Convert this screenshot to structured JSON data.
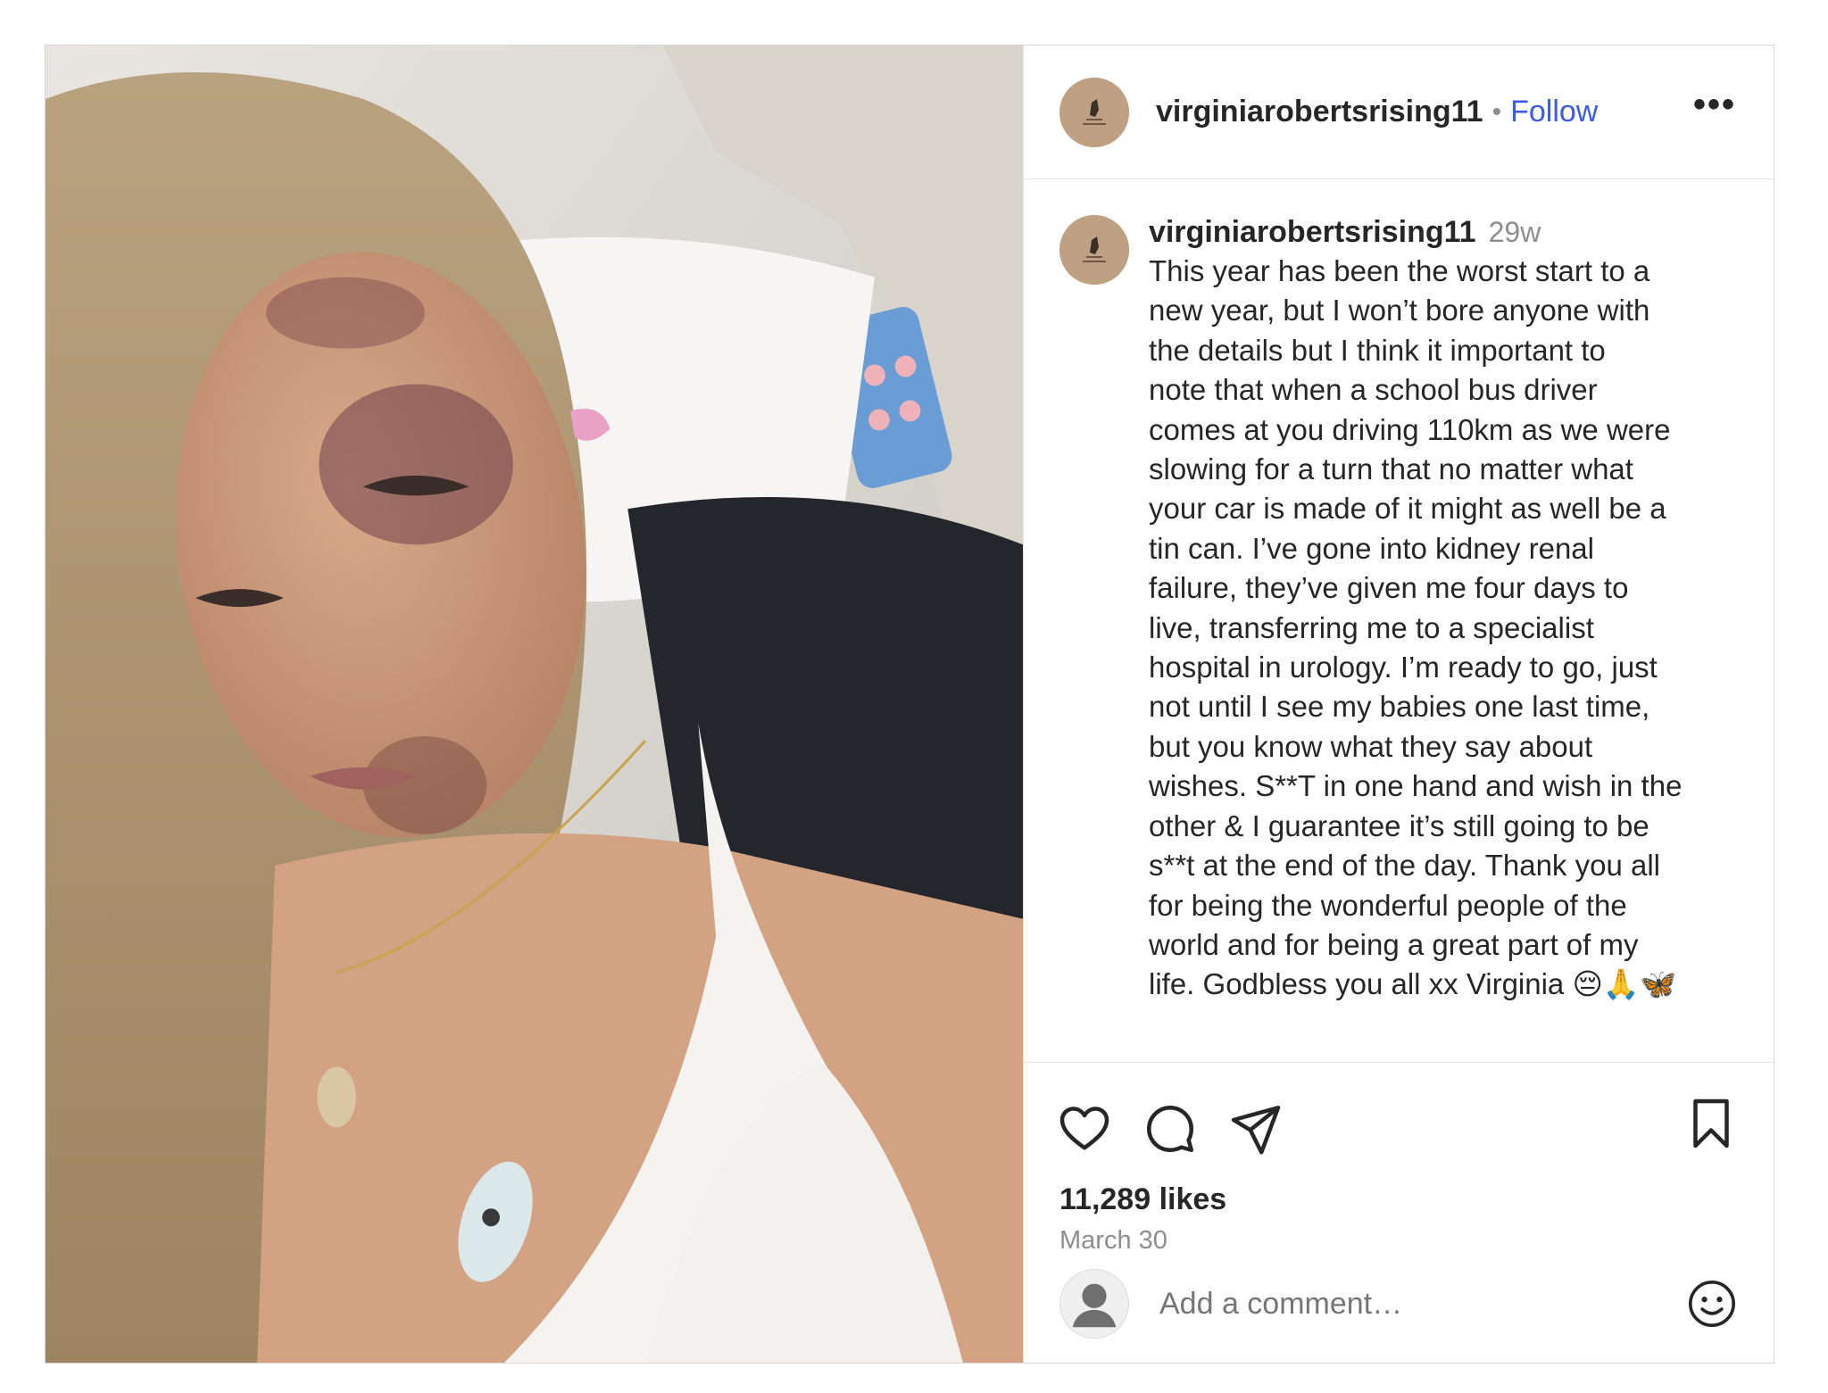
{
  "post": {
    "username": "virginiarobertsrising11",
    "separator": "•",
    "follow_label": "Follow",
    "more_label": "•••",
    "caption": {
      "username": "virginiarobertsrising11",
      "time_ago": "29w",
      "text": "This year has been the worst start to a\nnew year, but I won’t bore anyone with\nthe details but I think it important to\nnote that when a school bus driver\ncomes at you driving 110km as we were\nslowing for a turn that no matter what\nyour car is made of it might as well be a\ntin can. I’ve gone into kidney renal\nfailure, they’ve given me four days to\nlive, transferring me to a specialist\nhospital in urology. I’m ready to go, just\nnot until I see my babies one last time,\nbut you know what they say about\nwishes. S**T in one hand and wish in the\nother & I guarantee it’s still going to be\ns**t at the end of the day. Thank you all\nfor being the wonderful people of the\nworld and for being a great part of my\nlife. Godbless you all xx Virginia 😔🙏🦋"
    },
    "likes": "11,289 likes",
    "date": "March 30",
    "comment_placeholder": "Add a comment…",
    "icons": {
      "like": "heart-icon",
      "comment": "comment-icon",
      "share": "paper-plane-icon",
      "save": "bookmark-icon",
      "emoji": "smiley-icon",
      "avatar": "avatar-logo-icon"
    },
    "colors": {
      "follow": "#3b5af0",
      "muted": "#8e8e8e",
      "text": "#262626",
      "border": "#d6d6d6"
    }
  }
}
